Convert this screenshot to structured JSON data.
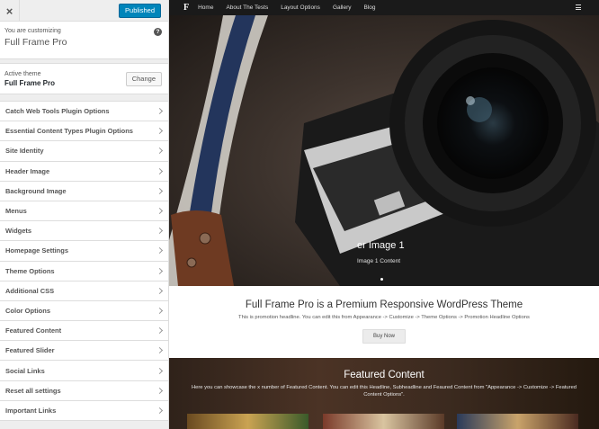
{
  "sidebar": {
    "close_label": "×",
    "publish_label": "Published",
    "customizing_label": "You are customizing",
    "site_name": "Full Frame Pro",
    "help_label": "?",
    "active_theme_label": "Active theme",
    "active_theme_name": "Full Frame Pro",
    "change_label": "Change",
    "sections": [
      "Catch Web Tools Plugin Options",
      "Essential Content Types Plugin Options",
      "Site Identity",
      "Header Image",
      "Background Image",
      "Menus",
      "Widgets",
      "Homepage Settings",
      "Theme Options",
      "Additional CSS",
      "Color Options",
      "Featured Content",
      "Featured Slider",
      "Social Links",
      "Reset all settings",
      "Important Links"
    ]
  },
  "preview": {
    "logo": "F",
    "nav": [
      "Home",
      "About The Tests",
      "Layout Options",
      "Gallery",
      "Blog"
    ],
    "slider": {
      "title": "er Image 1",
      "subtitle": "Image 1 Content"
    },
    "promo": {
      "title": "Full Frame Pro is a Premium Responsive WordPress Theme",
      "text": "This is promotion headline. You can edit this from Appearance -> Customize -> Theme Options -> Promotion Headline Options",
      "button": "Buy Now"
    },
    "featured": {
      "title": "Featured Content",
      "text": "Here you can showcase the x number of Featured Content. You can edit this Headline, Subheadline and Feaured Content from \"Appearance -> Customize -> Featured Content Options\"."
    }
  },
  "colors": {
    "publish_button": "#0085ba",
    "nav_bar": "#1a1a1a",
    "sidebar_bg": "#eeeeee"
  }
}
